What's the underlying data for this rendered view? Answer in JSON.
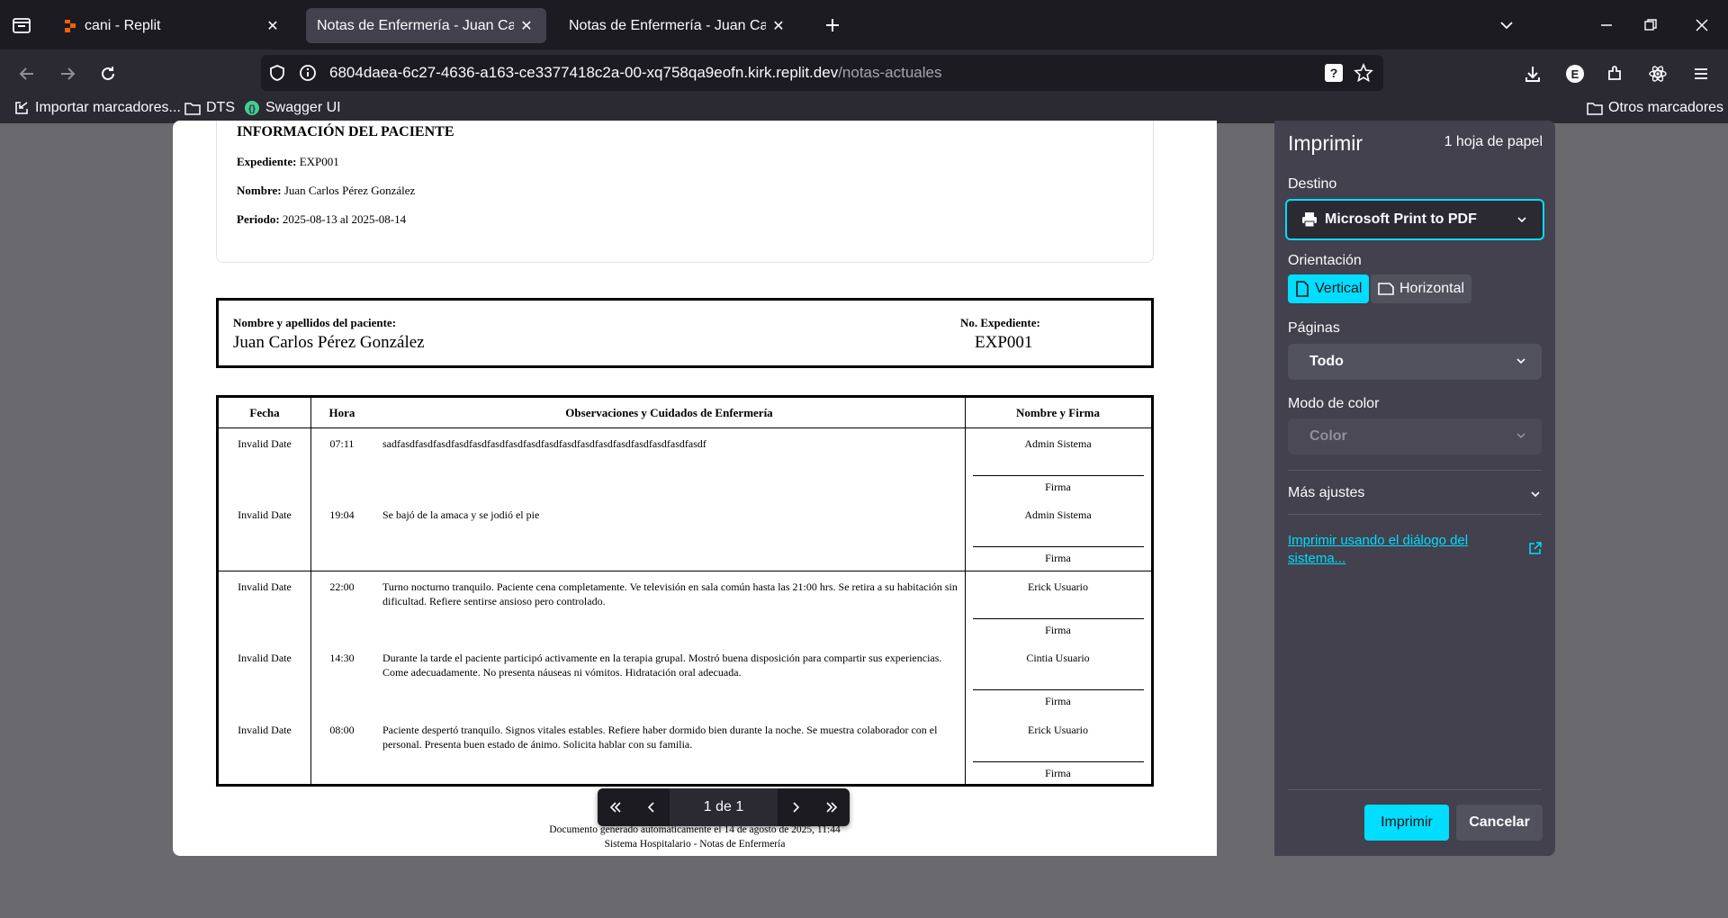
{
  "tabs": [
    {
      "title": "cani - Replit"
    },
    {
      "title": "Notas de Enfermería - Juan Carlos Pérez González"
    },
    {
      "title": "Notas de Enfermería - Juan Carlos Pérez González"
    }
  ],
  "url": {
    "host": "6804daea-6c27-4636-a163-ce3377418c2a-00-xq758qa9eofn.kirk.replit.dev",
    "path": "/notas-actuales"
  },
  "bookmarks": [
    "Importar marcadores...",
    "DTS",
    "Swagger UI"
  ],
  "bookmarks_other": "Otros marcadores",
  "document": {
    "info_title": "INFORMACIÓN DEL PACIENTE",
    "expediente_label": "Expediente:",
    "expediente_value": "EXP001",
    "nombre_label": "Nombre:",
    "nombre_value": "Juan Carlos Pérez González",
    "periodo_label": "Periodo:",
    "periodo_value": "2025-08-13 al 2025-08-14",
    "patient_label": "Nombre y apellidos del paciente:",
    "patient_value": "Juan Carlos Pérez González",
    "exp_label": "No. Expediente:",
    "exp_value": "EXP001",
    "headers": [
      "Fecha",
      "Hora",
      "Observaciones y Cuidados de Enfermería",
      "Nombre y Firma"
    ],
    "firma_label": "Firma",
    "rows": [
      {
        "fecha": "Invalid Date",
        "hora": "07:11",
        "obs": "sadfasdfasdfasdfasdfasdfasdfasdfasdfasdfasdfasdfasdfasdfasdfasdfasdfasdf",
        "nombre": "Admin Sistema"
      },
      {
        "fecha": "Invalid Date",
        "hora": "19:04",
        "obs": "Se bajó de la amaca y se jodió el pie",
        "nombre": "Admin Sistema"
      },
      {
        "fecha": "Invalid Date",
        "hora": "22:00",
        "obs": "Turno nocturno tranquilo. Paciente cena completamente. Ve televisión en sala común hasta las 21:00 hrs. Se retira a su habitación sin dificultad. Refiere sentirse ansioso pero controlado.",
        "nombre": "Erick Usuario"
      },
      {
        "fecha": "Invalid Date",
        "hora": "14:30",
        "obs": "Durante la tarde el paciente participó activamente en la terapia grupal. Mostró buena disposición para compartir sus experiencias. Come adecuadamente. No presenta náuseas ni vómitos. Hidratación oral adecuada.",
        "nombre": "Cintia Usuario"
      },
      {
        "fecha": "Invalid Date",
        "hora": "08:00",
        "obs": "Paciente despertó tranquilo. Signos vitales estables. Refiere haber dormido bien durante la noche. Se muestra colaborador con el personal. Presenta buen estado de ánimo. Solicita hablar con su familia.",
        "nombre": "Erick Usuario"
      }
    ],
    "footer1": "Documento generado automáticamente el 14 de agosto de 2025, 11:44",
    "footer2": "Sistema Hospitalario - Notas de Enfermería"
  },
  "pagenav": {
    "count": "1 de 1"
  },
  "print": {
    "title": "Imprimir",
    "sheets": "1 hoja de papel",
    "destino_label": "Destino",
    "destino_value": "Microsoft Print to PDF",
    "orientacion_label": "Orientación",
    "vertical": "Vertical",
    "horizontal": "Horizontal",
    "paginas_label": "Páginas",
    "paginas_value": "Todo",
    "color_label": "Modo de color",
    "color_value": "Color",
    "mas_ajustes": "Más ajustes",
    "system_link": "Imprimir usando el diálogo del sistema...",
    "print_button": "Imprimir",
    "cancel_button": "Cancelar"
  },
  "colors": {
    "accent": "#00ddff",
    "panel": "#42414d",
    "tabstrip": "#1c1b22"
  }
}
